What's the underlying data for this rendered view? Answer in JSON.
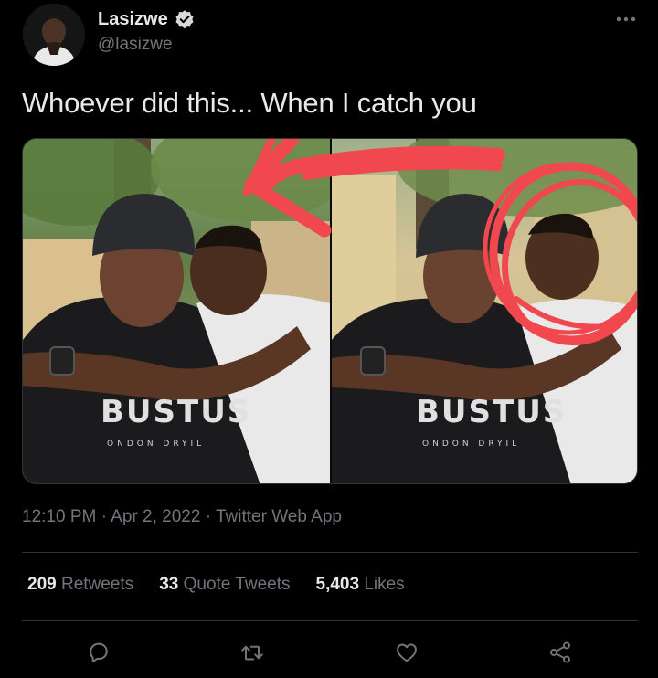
{
  "colors": {
    "background": "#000000",
    "text_primary": "#e7e9ea",
    "text_secondary": "#71767b",
    "verified_badge": "#d9d9d9",
    "divider": "#2f3336",
    "annotation_red": "#f0484e"
  },
  "author": {
    "display_name": "Lasizwe",
    "handle": "@lasizwe",
    "verified_icon": "verified-badge-icon",
    "avatar_icon": "profile-photo"
  },
  "tweet": {
    "text": "Whoever did this... When I catch you",
    "media": {
      "left_photo_print": [
        "BUSTUS",
        "ONDON DRYIL"
      ],
      "right_photo_print": [
        "BUSTUS",
        "ONDON DRYIL"
      ]
    },
    "time": "12:10 PM",
    "date": "Apr 2, 2022",
    "source": "Twitter Web App",
    "separator": "·"
  },
  "stats": {
    "retweets_count": "209",
    "retweets_label": "Retweets",
    "quotes_count": "33",
    "quotes_label": "Quote Tweets",
    "likes_count": "5,403",
    "likes_label": "Likes"
  },
  "actions": {
    "icons": [
      "reply-icon",
      "retweet-icon",
      "like-icon",
      "share-icon"
    ]
  }
}
